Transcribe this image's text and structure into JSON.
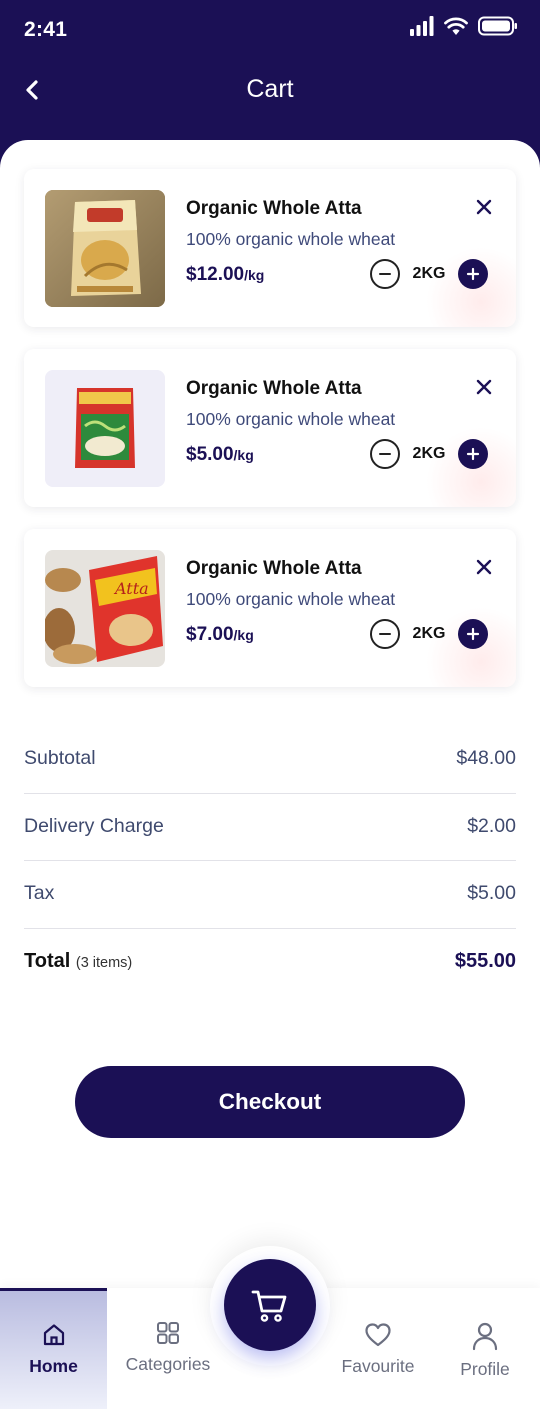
{
  "status_bar": {
    "time": "2:41"
  },
  "header": {
    "title": "Cart"
  },
  "cart_items": [
    {
      "name": "Organic Whole Atta",
      "description": "100% organic whole wheat",
      "price": "$12.00",
      "unit": "/kg",
      "quantity": "2KG"
    },
    {
      "name": "Organic Whole Atta",
      "description": "100% organic whole wheat",
      "price": "$5.00",
      "unit": "/kg",
      "quantity": "2KG"
    },
    {
      "name": "Organic Whole Atta",
      "description": "100% organic whole wheat",
      "price": "$7.00",
      "unit": "/kg",
      "quantity": "2KG"
    }
  ],
  "summary": {
    "subtotal_label": "Subtotal",
    "subtotal_value": "$48.00",
    "delivery_label": "Delivery Charge",
    "delivery_value": "$2.00",
    "tax_label": "Tax",
    "tax_value": "$5.00",
    "total_label": "Total",
    "total_items": "(3 items)",
    "total_value": "$55.00"
  },
  "checkout_label": "Checkout",
  "tabs": [
    {
      "label": "Home",
      "icon": "home-icon",
      "active": true
    },
    {
      "label": "Categories",
      "icon": "grid-icon",
      "active": false
    },
    {
      "label": "Favourite",
      "icon": "heart-icon",
      "active": false
    },
    {
      "label": "Profile",
      "icon": "person-icon",
      "active": false
    }
  ],
  "colors": {
    "primary": "#1b1055",
    "text_secondary": "#3f4a6e",
    "divider": "#e2e2e8"
  }
}
